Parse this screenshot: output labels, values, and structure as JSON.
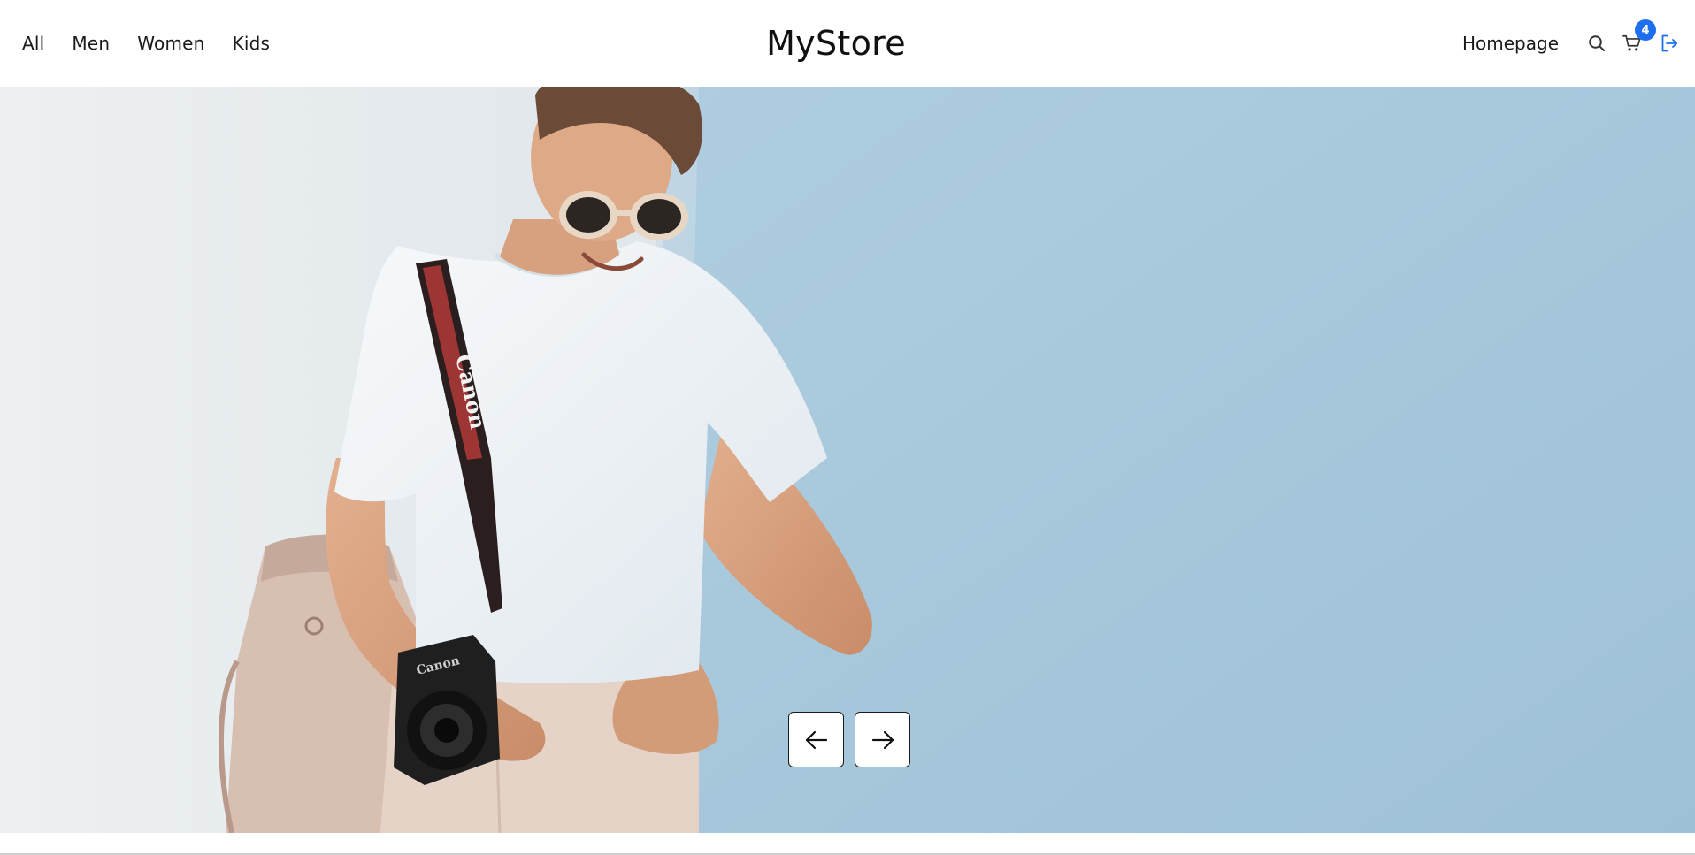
{
  "nav": {
    "left_links": [
      "All",
      "Men",
      "Women",
      "Kids"
    ],
    "brand": "MyStore",
    "homepage_label": "Homepage",
    "cart_count": "4"
  },
  "hero": {
    "strap_text": "Canon",
    "camera_text": "Canon"
  },
  "icons": {
    "search": "search-icon",
    "cart": "cart-icon",
    "logout": "logout-icon",
    "prev": "arrow-left-icon",
    "next": "arrow-right-icon"
  },
  "colors": {
    "accent": "#1e6ff0",
    "wall_blue": "#a6c7da",
    "wall_white": "#e8edf0"
  }
}
